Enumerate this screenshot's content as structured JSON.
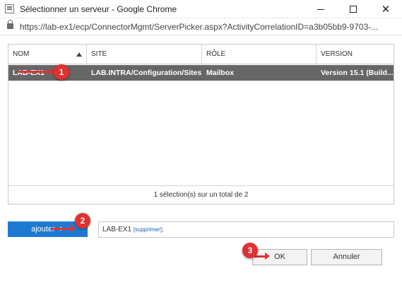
{
  "window": {
    "title": "Sélectionner un serveur - Google Chrome",
    "url": "https://lab-ex1/ecp/ConnectorMgmt/ServerPicker.aspx?ActivityCorrelationID=a3b05bb9-9703-..."
  },
  "grid": {
    "columns": [
      "NOM",
      "SITE",
      "RÔLE",
      "VERSION"
    ],
    "sorted_column": "NOM",
    "rows": [
      {
        "name": "LAB-EX1",
        "site": "LAB.INTRA/Configuration/Sites...",
        "role": "Mailbox",
        "version": "Version 15.1 (Build...",
        "selected": true
      }
    ],
    "footer": "1 sélection(s) sur un total de 2"
  },
  "add_button": "ajouter ->",
  "selection": {
    "server": "LAB-EX1",
    "remove_label": "[supprimer]",
    "separator": ";"
  },
  "buttons": {
    "ok": "OK",
    "cancel": "Annuler"
  },
  "annotations": {
    "marker_1": "1",
    "marker_2": "2",
    "marker_3": "3",
    "color": "#e03131"
  },
  "colors": {
    "selected_row": "#666666",
    "accent": "#1e7ad1"
  }
}
